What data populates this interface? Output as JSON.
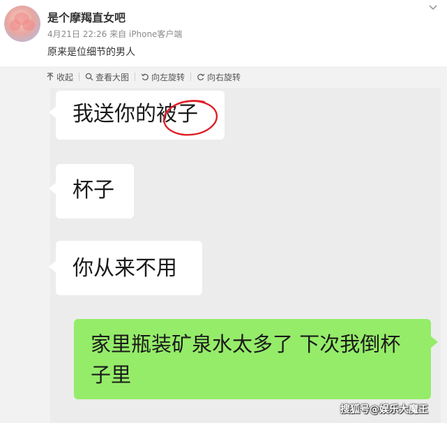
{
  "post": {
    "username": "是个摩羯直女吧",
    "meta": "4月21日 22:26 来自 iPhone客户端",
    "text": "原来是位细节的男人"
  },
  "toolbar": {
    "collapse": "收起",
    "view_large": "查看大图",
    "rotate_left": "向左旋转",
    "rotate_right": "向右旋转"
  },
  "chat": {
    "messages": [
      {
        "side": "left",
        "text": "我送你的被子"
      },
      {
        "side": "left",
        "text": "杯子"
      },
      {
        "side": "left",
        "text": "你从来不用"
      },
      {
        "side": "right",
        "text": "家里瓶装矿泉水太多了 下次我倒杯子里"
      }
    ]
  },
  "watermark": "搜狐号@娱乐大魔王",
  "colors": {
    "bubble_left": "#ffffff",
    "bubble_right": "#95ec69",
    "chat_bg": "#ececec",
    "annotation": "#e0202a"
  }
}
